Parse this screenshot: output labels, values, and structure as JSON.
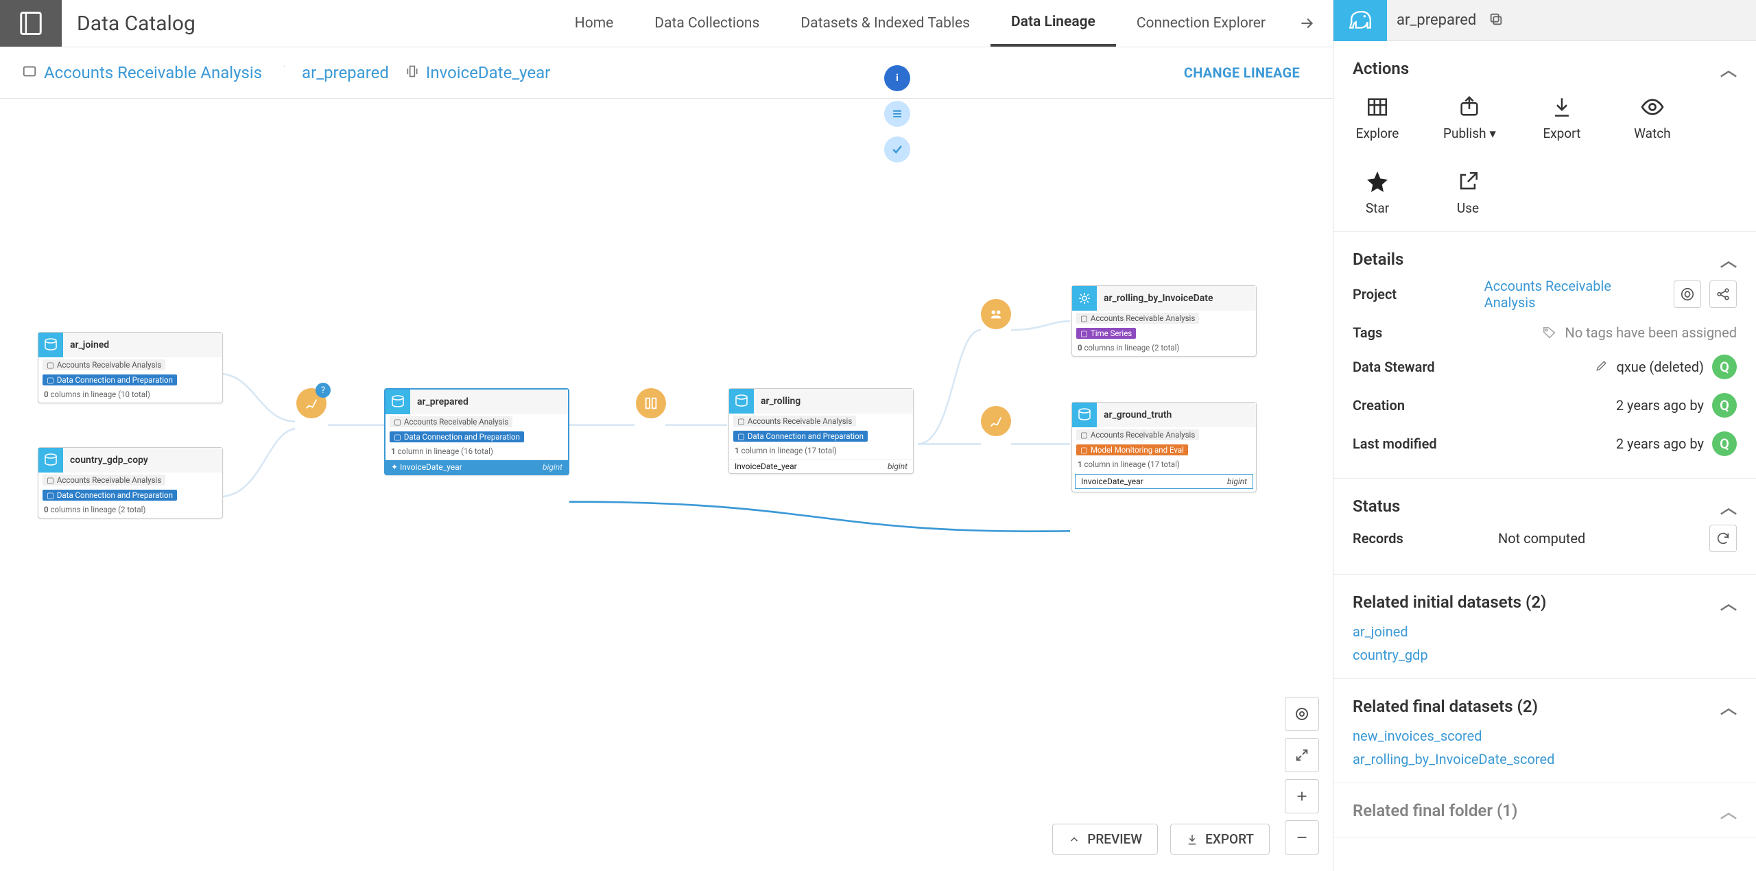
{
  "app": {
    "title": "Data Catalog"
  },
  "nav": {
    "tabs": [
      {
        "label": "Home"
      },
      {
        "label": "Data Collections"
      },
      {
        "label": "Datasets & Indexed Tables"
      },
      {
        "label": "Data Lineage",
        "active": true
      },
      {
        "label": "Connection Explorer"
      }
    ]
  },
  "right_tab": {
    "name": "ar_prepared"
  },
  "breadcrumb": {
    "project": "Accounts Receivable Analysis",
    "dataset": "ar_prepared",
    "column": "InvoiceDate_year",
    "change": "CHANGE LINEAGE"
  },
  "canvas_buttons": {
    "preview": "PREVIEW",
    "export": "EXPORT"
  },
  "nodes": {
    "ar_joined": {
      "title": "ar_joined",
      "proj": "Accounts Receivable Analysis",
      "tag": "Data Connection and Preparation",
      "foot_prefix": "0",
      "foot_rest": " columns in lineage (10 total)"
    },
    "country_gdp_copy": {
      "title": "country_gdp_copy",
      "proj": "Accounts Receivable Analysis",
      "tag": "Data Connection and Preparation",
      "foot_prefix": "0",
      "foot_rest": " columns in lineage (2 total)"
    },
    "ar_prepared": {
      "title": "ar_prepared",
      "proj": "Accounts Receivable Analysis",
      "tag": "Data Connection and Preparation",
      "foot_prefix": "1",
      "foot_rest": " column in lineage (16 total)",
      "col": "InvoiceDate_year",
      "col_type": "bigint"
    },
    "ar_rolling": {
      "title": "ar_rolling",
      "proj": "Accounts Receivable Analysis",
      "tag": "Data Connection and Preparation",
      "foot_prefix": "1",
      "foot_rest": " column in lineage (17 total)",
      "col": "InvoiceDate_year",
      "col_type": "bigint"
    },
    "ar_rolling_by_invoice": {
      "title": "ar_rolling_by_InvoiceDate",
      "proj": "Accounts Receivable Analysis",
      "tag": "Time Series",
      "foot_prefix": "0",
      "foot_rest": " columns in lineage (2 total)"
    },
    "ar_ground_truth": {
      "title": "ar_ground_truth",
      "proj": "Accounts Receivable Analysis",
      "tag": "Model Monitoring and Eval",
      "foot_prefix": "1",
      "foot_rest": " column in lineage (17 total)",
      "col": "InvoiceDate_year",
      "col_type": "bigint"
    }
  },
  "sidebar": {
    "actions": {
      "heading": "Actions",
      "items": {
        "explore": "Explore",
        "publish": "Publish",
        "export": "Export",
        "watch": "Watch",
        "star": "Star",
        "use": "Use"
      }
    },
    "details": {
      "heading": "Details",
      "project_k": "Project",
      "project_v": "Accounts Receivable Analysis",
      "tags_k": "Tags",
      "tags_v": "No tags have been assigned",
      "steward_k": "Data Steward",
      "steward_v": "qxue (deleted)",
      "steward_initial": "Q",
      "creation_k": "Creation",
      "creation_v": "2 years ago by",
      "creation_initial": "Q",
      "modified_k": "Last modified",
      "modified_v": "2 years ago by",
      "modified_initial": "Q"
    },
    "status": {
      "heading": "Status",
      "records_k": "Records",
      "records_v": "Not computed"
    },
    "rel_initial": {
      "heading": "Related initial datasets (2)",
      "items": [
        "ar_joined",
        "country_gdp"
      ]
    },
    "rel_final": {
      "heading": "Related final datasets (2)",
      "items": [
        "new_invoices_scored",
        "ar_rolling_by_InvoiceDate_scored"
      ]
    },
    "rel_folder": {
      "heading": "Related final folder (1)"
    }
  }
}
